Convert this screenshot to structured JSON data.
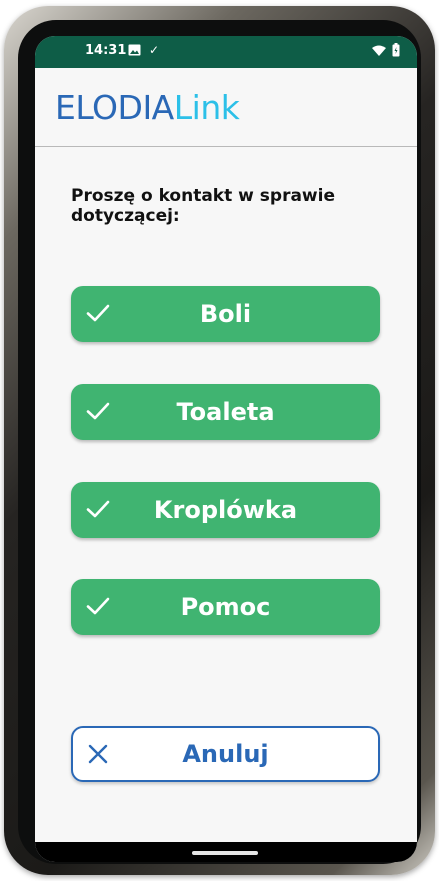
{
  "status_bar": {
    "time": "14:31",
    "icons": [
      "image-icon",
      "check-icon",
      "wifi-icon",
      "battery-icon"
    ],
    "background": "#0e5d47"
  },
  "header": {
    "logo_part1": "ELODIA",
    "logo_part2": "Link",
    "logo_colors": [
      "#2a68b6",
      "#2cc0e8"
    ]
  },
  "prompt": "Proszę o kontakt w sprawie dotyczącej:",
  "choices": [
    {
      "label": "Boli",
      "icon": "check-icon"
    },
    {
      "label": "Toaleta",
      "icon": "check-icon"
    },
    {
      "label": "Kroplówka",
      "icon": "check-icon"
    },
    {
      "label": "Pomoc",
      "icon": "check-icon"
    }
  ],
  "cancel": {
    "label": "Anuluj",
    "icon": "close-icon"
  },
  "colors": {
    "choice_green": "#40b471",
    "cancel_blue": "#2a68b6",
    "screen_background": "#f7f7f7"
  }
}
